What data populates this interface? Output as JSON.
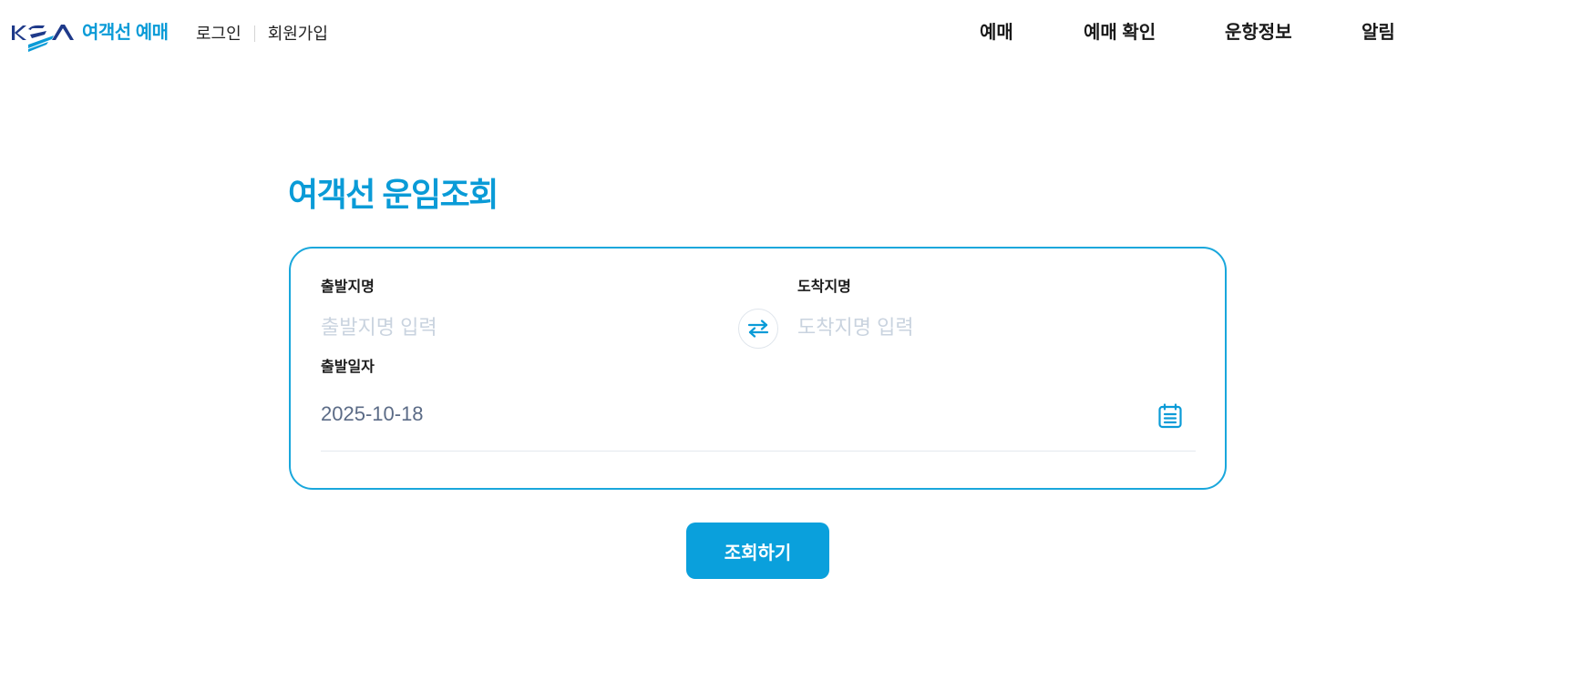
{
  "header": {
    "logo_text": "KSA",
    "brand": "여객선 예매",
    "auth": {
      "login": "로그인",
      "signup": "회원가입"
    },
    "nav": [
      {
        "label": "예매"
      },
      {
        "label": "예매 확인"
      },
      {
        "label": "운항정보"
      },
      {
        "label": "알림"
      }
    ]
  },
  "main": {
    "title": "여객선 운임조회",
    "departure": {
      "label": "출발지명",
      "placeholder": "출발지명 입력",
      "value": ""
    },
    "arrival": {
      "label": "도착지명",
      "placeholder": "도착지명 입력",
      "value": ""
    },
    "date": {
      "label": "출발일자",
      "value": "2025-10-18"
    },
    "swap_icon": "swap-arrows-icon",
    "calendar_icon": "calendar-icon",
    "submit_label": "조회하기"
  },
  "colors": {
    "accent": "#0a9bd7",
    "logo_navy": "#1f3a8a",
    "button": "#0aa0dc",
    "placeholder": "#c9d3df",
    "value_text": "#5b6b86"
  }
}
